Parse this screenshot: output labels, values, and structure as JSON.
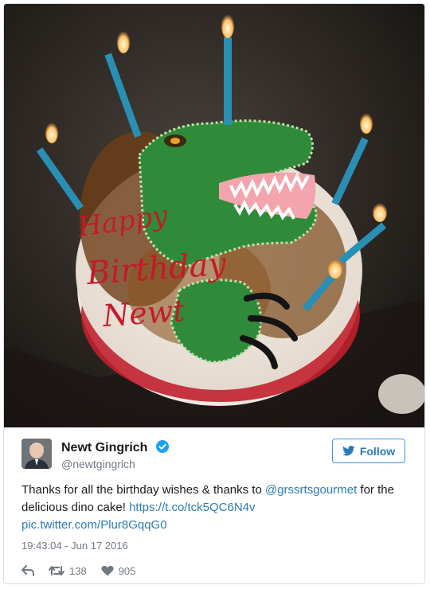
{
  "tweet": {
    "author_name": "Newt Gingrich",
    "author_handle": "@newtgingrich",
    "follow_label": "Follow",
    "text_part1": "Thanks for all the birthday wishes & thanks to ",
    "mention": "@grssrtsgourmet",
    "text_part2": " for the delicious dino cake! ",
    "link": "https://t.co/tck5QC6N4v",
    "pic_link": "pic.twitter.com/Plur8GqqG0",
    "timestamp": "19:43:04 - Jun 17 2016",
    "retweet_count": "138",
    "like_count": "905"
  },
  "photo": {
    "cake_text": [
      "Happy",
      "Birthday",
      "Newt"
    ]
  },
  "icons": {
    "verified": "verified-badge-icon",
    "follow_bird": "twitter-bird-icon",
    "reply": "reply-icon",
    "retweet": "retweet-icon",
    "like": "heart-icon"
  },
  "colors": {
    "link": "#2b7bb9",
    "verified": "#1da1f2",
    "muted": "#707880"
  }
}
